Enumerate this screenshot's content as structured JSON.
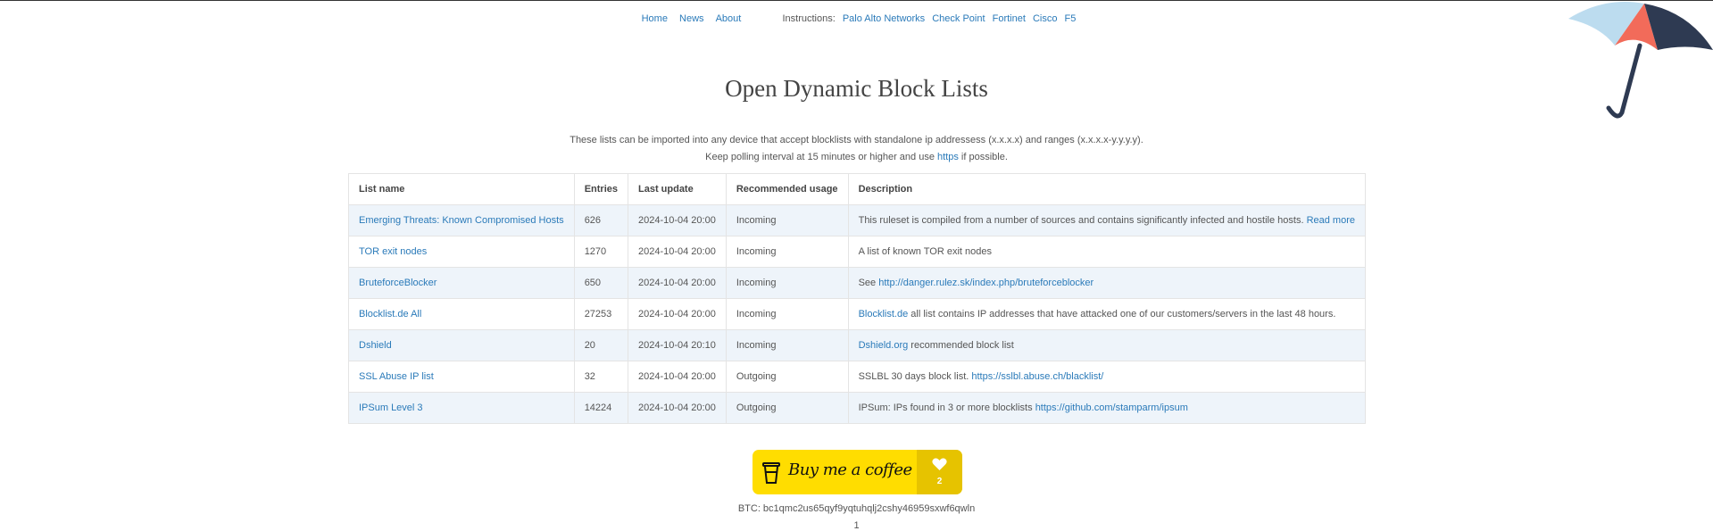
{
  "nav": {
    "home": "Home",
    "news": "News",
    "about": "About",
    "instructions_label": "Instructions:",
    "instructions": [
      "Palo Alto Networks",
      "Check Point",
      "Fortinet",
      "Cisco",
      "F5"
    ]
  },
  "title": "Open Dynamic Block Lists",
  "intro": {
    "line1": "These lists can be imported into any device that accept blocklists with standalone ip addressess (x.x.x.x) and ranges (x.x.x.x-y.y.y.y).",
    "line2_pre": "Keep polling interval at 15 minutes or higher and use ",
    "line2_link": "https",
    "line2_post": " if possible."
  },
  "table": {
    "headers": [
      "List name",
      "Entries",
      "Last update",
      "Recommended usage",
      "Description"
    ],
    "rows": [
      {
        "name": "Emerging Threats: Known Compromised Hosts",
        "entries": "626",
        "updated": "2024-10-04 20:00",
        "usage": "Incoming",
        "desc_link_pre": "",
        "desc_text": "This ruleset is compiled from a number of sources and contains significantly infected and hostile hosts. ",
        "desc_link_post": "Read more"
      },
      {
        "name": "TOR exit nodes",
        "entries": "1270",
        "updated": "2024-10-04 20:00",
        "usage": "Incoming",
        "desc_link_pre": "",
        "desc_text": "A list of known TOR exit nodes",
        "desc_link_post": ""
      },
      {
        "name": "BruteforceBlocker",
        "entries": "650",
        "updated": "2024-10-04 20:00",
        "usage": "Incoming",
        "desc_link_pre": "",
        "desc_text": "See ",
        "desc_link_post": "http://danger.rulez.sk/index.php/bruteforceblocker"
      },
      {
        "name": "Blocklist.de All",
        "entries": "27253",
        "updated": "2024-10-04 20:00",
        "usage": "Incoming",
        "desc_link_pre": "Blocklist.de",
        "desc_text": " all list contains IP addresses that have attacked one of our customers/servers in the last 48 hours.",
        "desc_link_post": ""
      },
      {
        "name": "Dshield",
        "entries": "20",
        "updated": "2024-10-04 20:10",
        "usage": "Incoming",
        "desc_link_pre": "Dshield.org",
        "desc_text": " recommended block list",
        "desc_link_post": ""
      },
      {
        "name": "SSL Abuse IP list",
        "entries": "32",
        "updated": "2024-10-04 20:00",
        "usage": "Outgoing",
        "desc_link_pre": "",
        "desc_text": "SSLBL 30 days block list. ",
        "desc_link_post": "https://sslbl.abuse.ch/blacklist/"
      },
      {
        "name": "IPSum Level 3",
        "entries": "14224",
        "updated": "2024-10-04 20:00",
        "usage": "Outgoing",
        "desc_link_pre": "",
        "desc_text": "IPSum: IPs found in 3 or more blocklists ",
        "desc_link_post": "https://github.com/stamparm/ipsum"
      }
    ]
  },
  "coffee": {
    "label": "Buy me a coffee",
    "count": "2"
  },
  "btc": "BTC: bc1qmc2us65qyf9yqtuhqlj2cshy46959sxwf6qwln",
  "page_number": "1",
  "colors": {
    "link": "#2a7ab9",
    "coffee_yellow": "#ffdd00",
    "row_stripe": "#eef4fa"
  }
}
